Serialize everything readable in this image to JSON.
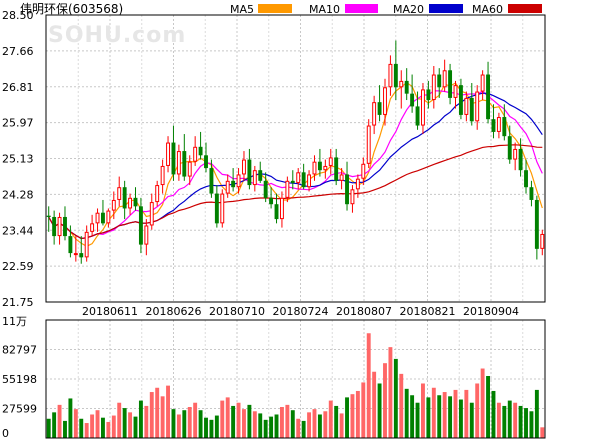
{
  "chart_data": {
    "type": "candlestick",
    "title": "伟明环保(603568)",
    "watermark": "SOHU.com",
    "legend": [
      {
        "name": "MA5",
        "color": "#ff9900"
      },
      {
        "name": "MA10",
        "color": "#ff00ff"
      },
      {
        "name": "MA20",
        "color": "#0000cc"
      },
      {
        "name": "MA60",
        "color": "#cc0000"
      }
    ],
    "price_axis": {
      "ticks": [
        "28.50",
        "27.66",
        "26.81",
        "25.97",
        "25.13",
        "24.28",
        "23.44",
        "22.59",
        "21.75"
      ],
      "ylim": [
        21.75,
        28.5
      ]
    },
    "date_labels": [
      "20180611",
      "20180626",
      "20180710",
      "20180724",
      "20180807",
      "20180821",
      "20180904"
    ],
    "volume_axis": {
      "unit": "11万",
      "ticks": [
        "82797",
        "55198",
        "27599",
        "0"
      ],
      "ylim": [
        0,
        110396
      ]
    },
    "colors": {
      "up": "#ff0000",
      "down": "#008000",
      "up_volume": "#ff6666",
      "down_volume": "#008000"
    },
    "candles": [
      [
        23.78,
        24.0,
        23.4,
        23.75
      ],
      [
        23.75,
        23.9,
        23.1,
        23.3
      ],
      [
        23.3,
        23.85,
        23.1,
        23.75
      ],
      [
        23.75,
        24.0,
        23.2,
        23.3
      ],
      [
        23.3,
        23.55,
        22.8,
        22.9
      ],
      [
        22.9,
        23.3,
        22.7,
        22.9
      ],
      [
        22.9,
        23.3,
        22.65,
        22.8
      ],
      [
        22.8,
        23.55,
        22.7,
        23.4
      ],
      [
        23.4,
        23.8,
        23.3,
        23.6
      ],
      [
        23.6,
        23.95,
        23.4,
        23.85
      ],
      [
        23.85,
        24.15,
        23.55,
        23.6
      ],
      [
        23.6,
        23.95,
        23.5,
        23.9
      ],
      [
        23.9,
        24.35,
        23.7,
        24.15
      ],
      [
        24.15,
        24.7,
        24.0,
        24.45
      ],
      [
        24.45,
        24.6,
        23.7,
        23.95
      ],
      [
        23.95,
        24.3,
        23.8,
        24.2
      ],
      [
        24.2,
        24.45,
        23.9,
        24.0
      ],
      [
        24.0,
        24.2,
        22.9,
        23.1
      ],
      [
        23.1,
        23.7,
        22.85,
        23.55
      ],
      [
        23.55,
        24.3,
        23.45,
        24.1
      ],
      [
        24.1,
        24.6,
        24.0,
        24.5
      ],
      [
        24.5,
        25.1,
        24.3,
        24.95
      ],
      [
        24.95,
        25.65,
        24.8,
        25.5
      ],
      [
        25.5,
        25.9,
        24.6,
        24.75
      ],
      [
        24.75,
        25.45,
        24.6,
        25.3
      ],
      [
        25.3,
        25.7,
        24.6,
        24.7
      ],
      [
        24.7,
        25.2,
        24.5,
        25.05
      ],
      [
        25.05,
        25.65,
        24.95,
        25.4
      ],
      [
        25.4,
        25.75,
        25.1,
        25.2
      ],
      [
        25.2,
        25.5,
        24.8,
        24.9
      ],
      [
        24.9,
        25.1,
        24.2,
        24.3
      ],
      [
        24.3,
        24.5,
        23.5,
        23.6
      ],
      [
        23.6,
        24.4,
        23.5,
        24.3
      ],
      [
        24.3,
        24.75,
        24.2,
        24.6
      ],
      [
        24.6,
        24.9,
        24.35,
        24.45
      ],
      [
        24.45,
        24.9,
        24.3,
        24.75
      ],
      [
        24.75,
        25.3,
        24.6,
        25.1
      ],
      [
        25.1,
        25.35,
        24.4,
        24.5
      ],
      [
        24.5,
        24.95,
        24.35,
        24.85
      ],
      [
        24.85,
        25.05,
        24.55,
        24.6
      ],
      [
        24.6,
        24.8,
        24.1,
        24.2
      ],
      [
        24.2,
        24.45,
        23.95,
        24.05
      ],
      [
        24.05,
        24.3,
        23.6,
        23.7
      ],
      [
        23.7,
        24.35,
        23.5,
        24.2
      ],
      [
        24.2,
        24.7,
        24.1,
        24.6
      ],
      [
        24.6,
        24.85,
        24.4,
        24.55
      ],
      [
        24.55,
        24.9,
        24.4,
        24.8
      ],
      [
        24.8,
        25.0,
        24.4,
        24.45
      ],
      [
        24.45,
        24.85,
        24.35,
        24.75
      ],
      [
        24.75,
        25.2,
        24.6,
        25.05
      ],
      [
        25.05,
        25.35,
        24.7,
        24.85
      ],
      [
        24.85,
        25.1,
        24.65,
        24.95
      ],
      [
        24.95,
        25.35,
        24.75,
        25.15
      ],
      [
        25.15,
        25.35,
        24.5,
        24.6
      ],
      [
        24.6,
        24.9,
        24.4,
        24.75
      ],
      [
        24.75,
        25.05,
        23.9,
        24.05
      ],
      [
        24.05,
        24.5,
        23.85,
        24.4
      ],
      [
        24.4,
        24.75,
        24.2,
        24.65
      ],
      [
        24.65,
        25.15,
        24.5,
        25.0
      ],
      [
        25.0,
        26.05,
        24.9,
        25.9
      ],
      [
        25.9,
        26.6,
        25.7,
        26.45
      ],
      [
        26.45,
        26.85,
        26.0,
        26.15
      ],
      [
        26.15,
        27.0,
        25.9,
        26.8
      ],
      [
        26.8,
        27.55,
        26.6,
        27.35
      ],
      [
        27.35,
        27.9,
        26.5,
        26.8
      ],
      [
        26.8,
        27.2,
        26.3,
        26.95
      ],
      [
        26.95,
        27.25,
        26.5,
        26.65
      ],
      [
        26.65,
        27.1,
        26.2,
        26.35
      ],
      [
        26.35,
        26.7,
        25.8,
        25.9
      ],
      [
        25.9,
        26.9,
        25.7,
        26.75
      ],
      [
        26.75,
        26.95,
        26.3,
        26.5
      ],
      [
        26.5,
        27.3,
        26.3,
        27.1
      ],
      [
        27.1,
        27.25,
        26.55,
        26.8
      ],
      [
        26.8,
        27.45,
        26.7,
        27.2
      ],
      [
        27.2,
        27.35,
        26.4,
        26.55
      ],
      [
        26.55,
        26.95,
        26.3,
        26.85
      ],
      [
        26.85,
        27.0,
        26.05,
        26.15
      ],
      [
        26.15,
        26.7,
        26.0,
        26.55
      ],
      [
        26.55,
        26.9,
        25.9,
        26.0
      ],
      [
        26.0,
        26.85,
        25.8,
        26.7
      ],
      [
        26.7,
        27.2,
        26.5,
        27.1
      ],
      [
        27.1,
        27.4,
        25.95,
        26.05
      ],
      [
        26.05,
        26.4,
        25.6,
        25.75
      ],
      [
        25.75,
        26.2,
        25.6,
        26.1
      ],
      [
        26.1,
        26.4,
        25.55,
        25.65
      ],
      [
        25.65,
        25.9,
        25.0,
        25.1
      ],
      [
        25.1,
        25.5,
        24.85,
        25.35
      ],
      [
        25.35,
        25.6,
        24.7,
        24.85
      ],
      [
        24.85,
        25.1,
        24.3,
        24.45
      ],
      [
        24.45,
        24.6,
        24.0,
        24.15
      ],
      [
        24.15,
        24.25,
        22.75,
        23.0
      ],
      [
        23.0,
        23.45,
        22.85,
        23.35
      ]
    ],
    "volumes": [
      18000,
      24000,
      31000,
      16000,
      37000,
      27000,
      18000,
      14000,
      22000,
      26000,
      19000,
      15000,
      21000,
      33000,
      28000,
      24000,
      20000,
      35000,
      30000,
      43000,
      47000,
      39000,
      49000,
      27000,
      22000,
      26000,
      29000,
      33000,
      26000,
      19000,
      17000,
      21000,
      35000,
      38000,
      30000,
      33000,
      27000,
      31000,
      25000,
      23000,
      17000,
      20000,
      22000,
      29000,
      31000,
      26000,
      18000,
      16000,
      24000,
      27000,
      22000,
      25000,
      35000,
      30000,
      23000,
      38000,
      41000,
      44000,
      52000,
      98000,
      62000,
      51000,
      70000,
      85000,
      74000,
      60000,
      46000,
      40000,
      33000,
      51000,
      38000,
      47000,
      40000,
      43000,
      39000,
      45000,
      36000,
      45000,
      33000,
      51000,
      65000,
      58000,
      44000,
      33000,
      30000,
      35000,
      33000,
      30000,
      28000,
      25000,
      45000,
      10000
    ]
  }
}
